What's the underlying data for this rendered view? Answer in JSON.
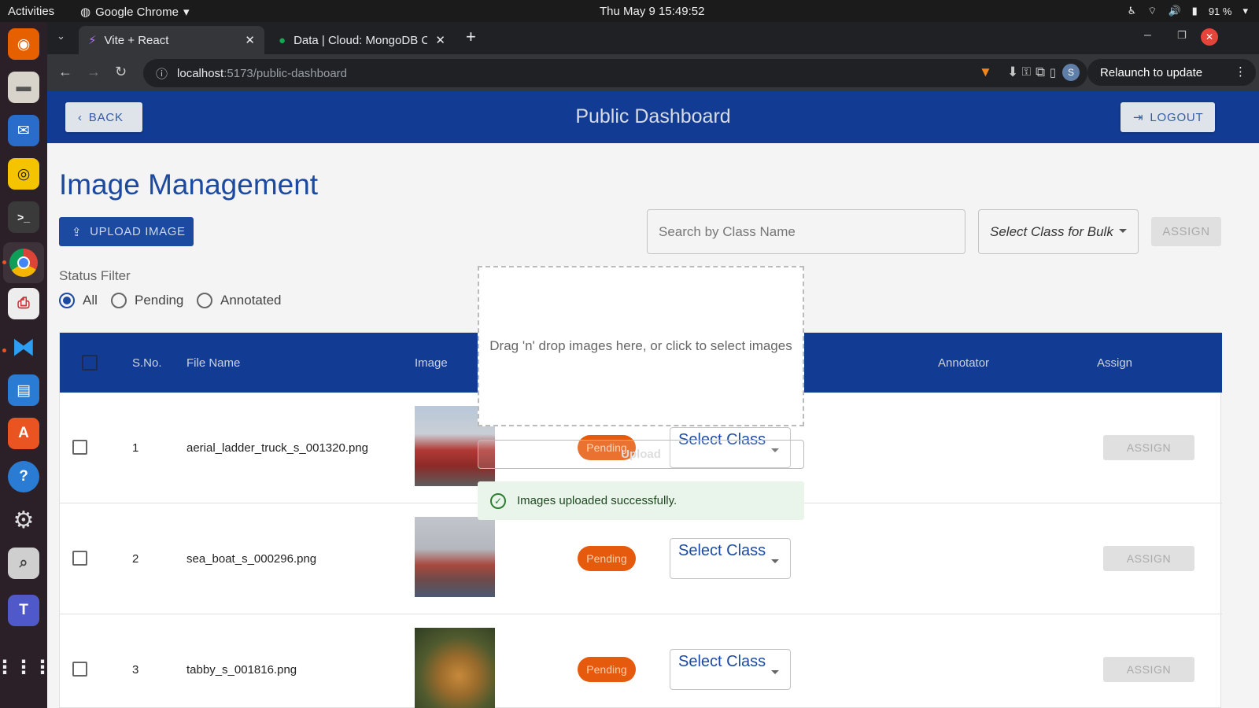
{
  "system": {
    "activities": "Activities",
    "app_name": "Google Chrome",
    "clock": "Thu May 9  15:49:52",
    "battery": "91 %"
  },
  "browser": {
    "tabs": [
      {
        "label": "Vite + React"
      },
      {
        "label": "Data | Cloud: MongoDB C"
      }
    ],
    "url_host": "localhost",
    "url_path": ":5173/public-dashboard",
    "relaunch": "Relaunch to update",
    "profile_initial": "S"
  },
  "appbar": {
    "back": "BACK",
    "title": "Public Dashboard",
    "logout": "LOGOUT"
  },
  "main": {
    "heading": "Image Management",
    "upload_image": "UPLOAD IMAGE",
    "search_placeholder": "Search by Class Name",
    "bulk_select": "Select Class for Bulk",
    "assign_bulk": "ASSIGN",
    "status_filter_label": "Status Filter",
    "filters": [
      "All",
      "Pending",
      "Annotated"
    ]
  },
  "table": {
    "headers": {
      "sno": "S.No.",
      "file": "File Name",
      "image": "Image",
      "annotator": "Annotator",
      "assign": "Assign"
    },
    "rows": [
      {
        "sno": "1",
        "file": "aerial_ladder_truck_s_001320.png",
        "status": "Pending",
        "class": "Select Class",
        "assign": "ASSIGN"
      },
      {
        "sno": "2",
        "file": "sea_boat_s_000296.png",
        "status": "Pending",
        "class": "Select Class",
        "assign": "ASSIGN"
      },
      {
        "sno": "3",
        "file": "tabby_s_001816.png",
        "status": "Pending",
        "class": "Select Class",
        "assign": "ASSIGN"
      }
    ]
  },
  "upload_dialog": {
    "dropzone_text": "Drag 'n' drop images here, or click to select images",
    "upload_button": "Upload",
    "toast": "Images uploaded successfully."
  }
}
